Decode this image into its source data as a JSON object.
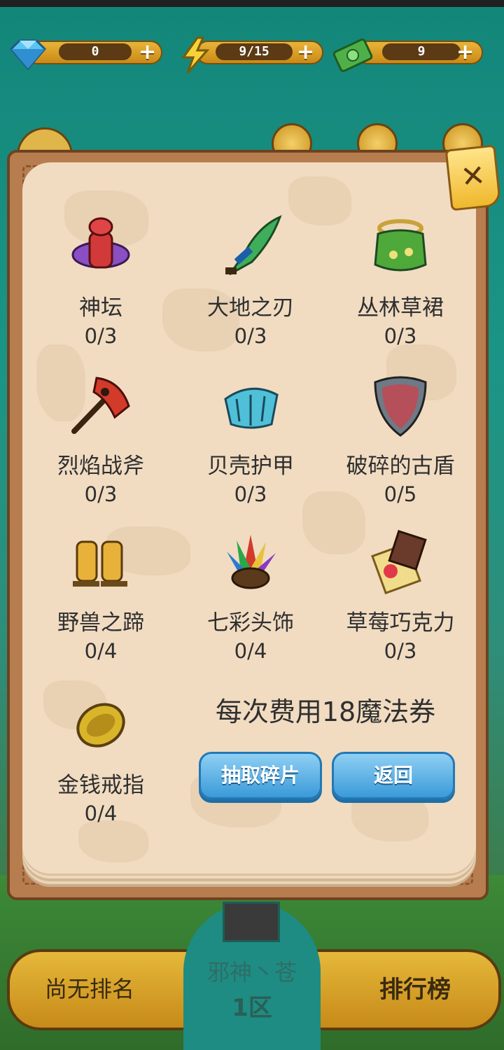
{
  "resources": {
    "gems": {
      "value": "0",
      "icon": "diamond-icon"
    },
    "energy": {
      "value": "9/15",
      "icon": "lightning-icon"
    },
    "cash": {
      "value": "9",
      "icon": "money-icon"
    }
  },
  "items": [
    {
      "name": "神坛",
      "count": "0/3",
      "icon": "altar-icon"
    },
    {
      "name": "大地之刃",
      "count": "0/3",
      "icon": "blade-icon"
    },
    {
      "name": "丛林草裙",
      "count": "0/3",
      "icon": "grass-skirt-icon"
    },
    {
      "name": "烈焰战斧",
      "count": "0/3",
      "icon": "axe-icon"
    },
    {
      "name": "贝壳护甲",
      "count": "0/3",
      "icon": "shell-armor-icon"
    },
    {
      "name": "破碎的古盾",
      "count": "0/5",
      "icon": "shield-icon"
    },
    {
      "name": "野兽之蹄",
      "count": "0/4",
      "icon": "boots-icon"
    },
    {
      "name": "七彩头饰",
      "count": "0/4",
      "icon": "headdress-icon"
    },
    {
      "name": "草莓巧克力",
      "count": "0/3",
      "icon": "chocolate-icon"
    },
    {
      "name": "金钱戒指",
      "count": "0/4",
      "icon": "ring-icon"
    }
  ],
  "cost_text": "每次费用18魔法券",
  "buttons": {
    "draw": "抽取碎片",
    "back": "返回"
  },
  "bottom": {
    "rank": "尚无排名",
    "player": "邪神丶苍",
    "zone": "1区",
    "leaderboard": "排行榜"
  }
}
